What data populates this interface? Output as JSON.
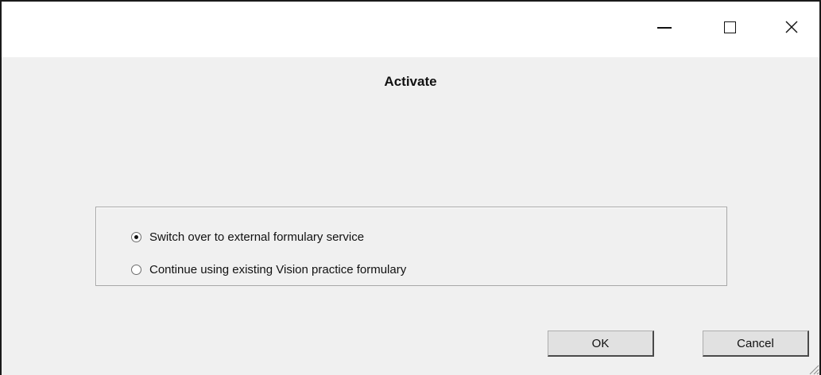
{
  "titlebar": {
    "controls": [
      "minimize",
      "maximize",
      "close"
    ]
  },
  "dialog": {
    "title": "Activate",
    "options": [
      {
        "label": "Switch over to external formulary service",
        "selected": true
      },
      {
        "label": "Continue using existing Vision practice formulary",
        "selected": false
      }
    ],
    "ok_label": "OK",
    "cancel_label": "Cancel"
  },
  "icons": {
    "minimize": "minimize-icon",
    "maximize": "maximize-icon",
    "close": "close-icon",
    "grip": "resize-grip-icon"
  }
}
